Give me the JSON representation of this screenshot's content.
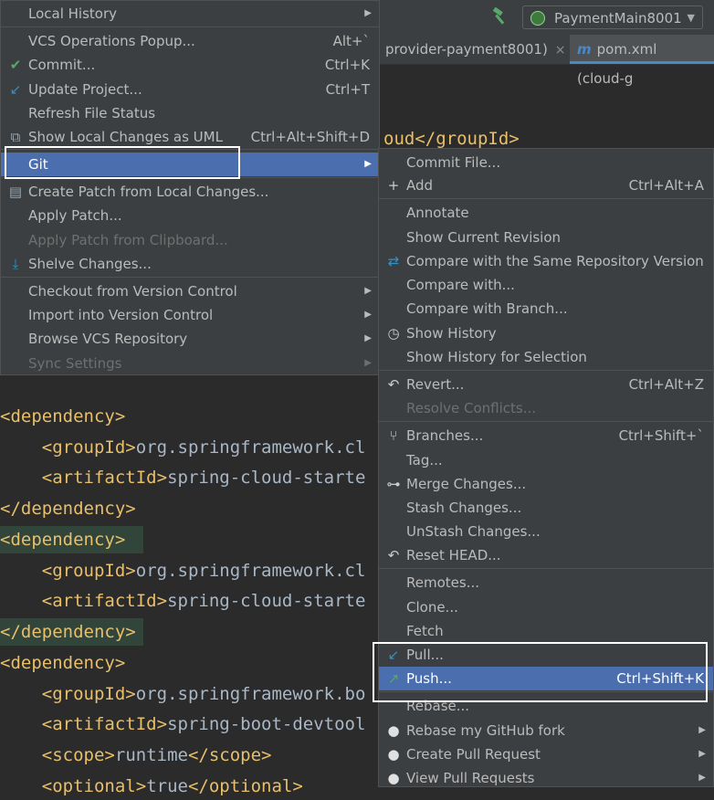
{
  "toolbar": {
    "run_config": "PaymentMain8001"
  },
  "tabs": [
    {
      "label": "provider-payment8001)",
      "close": "×"
    },
    {
      "label": "pom.xml (cloud-g",
      "icon": "m"
    }
  ],
  "editor": {
    "line_top_fragment": "oud</groupId>",
    "lines": [
      {
        "indent": "",
        "tag": "dependency",
        "closing": false
      },
      {
        "indent": "    ",
        "tag": "groupId",
        "text": "org.springframework.cl"
      },
      {
        "indent": "    ",
        "tag": "artifactId",
        "text": "spring-cloud-starte"
      },
      {
        "indent": "",
        "tag": "dependency",
        "closing": true
      },
      {
        "indent": "",
        "tag": "dependency",
        "closing": false
      },
      {
        "indent": "    ",
        "tag": "groupId",
        "text": "org.springframework.cl"
      },
      {
        "indent": "    ",
        "tag": "artifactId",
        "text": "spring-cloud-starte"
      },
      {
        "indent": "",
        "tag": "dependency",
        "closing": true
      },
      {
        "indent": "",
        "tag": "dependency",
        "closing": false
      },
      {
        "indent": "    ",
        "tag": "groupId",
        "text": "org.springframework.bo"
      },
      {
        "indent": "    ",
        "tag": "artifactId",
        "text": "spring-boot-devtool"
      },
      {
        "indent": "    ",
        "tag": "scope",
        "text": "runtime"
      },
      {
        "indent": "    ",
        "tag": "optional",
        "text": "true"
      }
    ]
  },
  "vcs_menu": {
    "items": [
      {
        "label": "Local History",
        "arrow": true
      },
      {
        "label": "VCS Operations Popup...",
        "shortcut": "Alt+`"
      },
      {
        "label": "Commit...",
        "shortcut": "Ctrl+K",
        "icon": "commit-check-icon"
      },
      {
        "label": "Update Project...",
        "shortcut": "Ctrl+T",
        "icon": "update-arrow-icon"
      },
      {
        "label": "Refresh File Status"
      },
      {
        "label": "Show Local Changes as UML",
        "shortcut": "Ctrl+Alt+Shift+D",
        "icon": "uml-diagram-icon"
      },
      {
        "label": "Git",
        "arrow": true,
        "selected": true
      },
      {
        "label": "Create Patch from Local Changes...",
        "icon": "patch-icon"
      },
      {
        "label": "Apply Patch..."
      },
      {
        "label": "Apply Patch from Clipboard...",
        "disabled": true
      },
      {
        "label": "Shelve Changes...",
        "icon": "shelve-icon"
      },
      {
        "label": "Checkout from Version Control",
        "arrow": true
      },
      {
        "label": "Import into Version Control",
        "arrow": true
      },
      {
        "label": "Browse VCS Repository",
        "arrow": true
      },
      {
        "label": "Sync Settings",
        "arrow": true,
        "disabled": true
      }
    ]
  },
  "git_menu": {
    "items": [
      {
        "label": "Commit File..."
      },
      {
        "label": "Add",
        "shortcut": "Ctrl+Alt+A",
        "icon": "plus-icon"
      },
      {
        "label": "Annotate"
      },
      {
        "label": "Show Current Revision"
      },
      {
        "label": "Compare with the Same Repository Version",
        "icon": "compare-icon"
      },
      {
        "label": "Compare with..."
      },
      {
        "label": "Compare with Branch..."
      },
      {
        "label": "Show History",
        "icon": "clock-icon"
      },
      {
        "label": "Show History for Selection"
      },
      {
        "label": "Revert...",
        "shortcut": "Ctrl+Alt+Z",
        "icon": "revert-icon"
      },
      {
        "label": "Resolve Conflicts...",
        "disabled": true
      },
      {
        "label": "Branches...",
        "shortcut": "Ctrl+Shift+`",
        "icon": "branch-icon"
      },
      {
        "label": "Tag..."
      },
      {
        "label": "Merge Changes...",
        "icon": "merge-icon"
      },
      {
        "label": "Stash Changes..."
      },
      {
        "label": "UnStash Changes..."
      },
      {
        "label": "Reset HEAD...",
        "icon": "reset-icon"
      },
      {
        "label": "Remotes..."
      },
      {
        "label": "Clone..."
      },
      {
        "label": "Fetch"
      },
      {
        "label": "Pull...",
        "icon": "pull-arrow-icon"
      },
      {
        "label": "Push...",
        "shortcut": "Ctrl+Shift+K",
        "icon": "push-arrow-icon",
        "selected": true
      },
      {
        "label": "Rebase..."
      },
      {
        "label": "Rebase my GitHub fork",
        "arrow": true,
        "icon": "github-icon"
      },
      {
        "label": "Create Pull Request",
        "arrow": true,
        "icon": "github-icon"
      },
      {
        "label": "View Pull Requests",
        "arrow": true,
        "icon": "github-icon"
      }
    ]
  },
  "colors": {
    "menu_bg": "#3c3f41",
    "selection": "#4b6eaf",
    "xml_tag": "#e8bf6a",
    "editor_bg": "#2b2b2b"
  }
}
